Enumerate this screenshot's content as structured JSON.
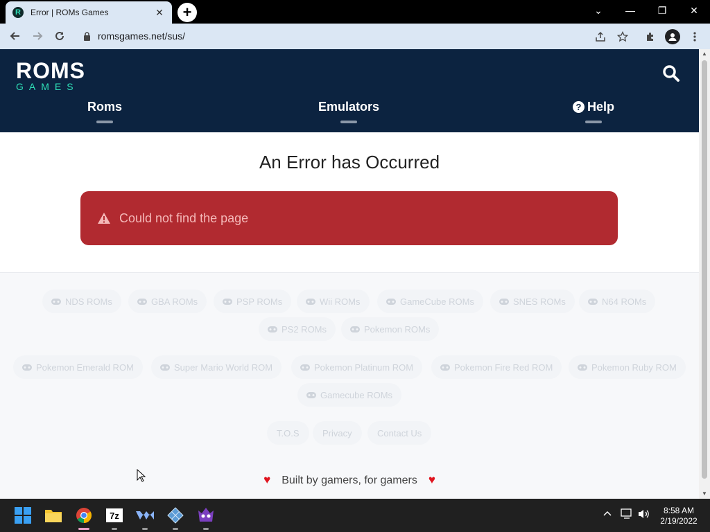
{
  "browser": {
    "tab_title": "Error | ROMs Games",
    "favicon_letter": "R",
    "new_tab_label": "+",
    "url": "romsgames.net/sus/",
    "window_controls": {
      "dropdown": "⌄",
      "minimize": "—",
      "restore": "❐",
      "close": "✕"
    },
    "tab_close": "✕"
  },
  "site": {
    "logo_top": "ROMS",
    "logo_bottom": "GAMES",
    "nav": [
      {
        "label": "Roms"
      },
      {
        "label": "Emulators"
      },
      {
        "label": "Help",
        "icon": "?"
      }
    ]
  },
  "main": {
    "title": "An Error has Occurred",
    "alert_message": "Could not find the page"
  },
  "footer": {
    "console_links": [
      "NDS ROMs",
      "GBA ROMs",
      "PSP ROMs",
      "Wii ROMs",
      "GameCube ROMs",
      "SNES ROMs",
      "N64 ROMs",
      "PS2 ROMs",
      "Pokemon ROMs"
    ],
    "game_links": [
      "Pokemon Emerald ROM",
      "Super Mario World ROM",
      "Pokemon Platinum ROM",
      "Pokemon Fire Red ROM",
      "Pokemon Ruby ROM",
      "Gamecube ROMs"
    ],
    "legal_links": [
      "T.O.S",
      "Privacy",
      "Contact Us"
    ],
    "tagline": "Built by gamers, for gamers"
  },
  "taskbar": {
    "clock_time": "8:58 AM",
    "clock_date": "2/19/2022",
    "app_7z_label": "7z"
  },
  "colors": {
    "header_bg": "#0c2340",
    "logo_accent": "#2fe0b8",
    "alert_bg": "#b12a30",
    "alert_text": "#f4b8b8",
    "heart": "#e0141e"
  }
}
